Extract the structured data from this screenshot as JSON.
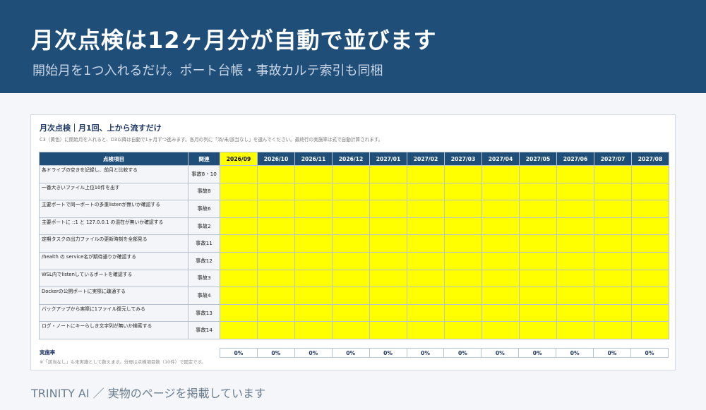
{
  "hero": {
    "title": "月次点検は12ヶ月分が自動で並びます",
    "subtitle": "開始月を1つ入れるだけ。ポート台帳・事故カルテ索引も同梱"
  },
  "sheet": {
    "title": "月次点検｜月1回、上から流すだけ",
    "description": "C3（黄色）に開始月を入れると、D3以降は自動で1ヶ月ずつ進みます。各月の列に「済/未/該当なし」を選んでください。最終行の実施率は式で自動計算されます。",
    "headers": {
      "item": "点検項目",
      "related": "関連"
    },
    "months": [
      "2026/09",
      "2026/10",
      "2026/11",
      "2026/12",
      "2027/01",
      "2027/02",
      "2027/03",
      "2027/04",
      "2027/05",
      "2027/06",
      "2027/07",
      "2027/08"
    ],
    "rows": [
      {
        "item": "各ドライブの空きを記録し、前月と比較する",
        "related": "事故8・10"
      },
      {
        "item": "一番大きいファイル上位10件を出す",
        "related": "事故8"
      },
      {
        "item": "主要ポートで同一ポートの多重listenが無いか確認する",
        "related": "事故6"
      },
      {
        "item": "主要ポートに ::1 と 127.0.0.1 の混在が無いか確認する",
        "related": "事故2"
      },
      {
        "item": "定期タスクの出力ファイルの更新時刻を全部見る",
        "related": "事故11"
      },
      {
        "item": "/health の service名が期待通りか確認する",
        "related": "事故12"
      },
      {
        "item": "WSL内でlistenしているポートを確認する",
        "related": "事故3"
      },
      {
        "item": "Dockerの公開ポートに実際に疎通する",
        "related": "事故4"
      },
      {
        "item": "バックアップから実際に1ファイル復元してみる",
        "related": "事故13"
      },
      {
        "item": "ログ・ノートにキーらしき文字列が無いか検索する",
        "related": "事故14"
      }
    ],
    "rate_label": "実施率",
    "rates": [
      "0%",
      "0%",
      "0%",
      "0%",
      "0%",
      "0%",
      "0%",
      "0%",
      "0%",
      "0%",
      "0%",
      "0%"
    ],
    "note": "※「該当なし」も未実施として数えます。分母は点検項目数（10件）で固定です。",
    "colors": {
      "header": "#1f4e79",
      "input_cell": "#ffff00",
      "label_cell": "#f3f5f8"
    }
  },
  "footer": "TRINITY AI ／ 実物のページを掲載しています"
}
